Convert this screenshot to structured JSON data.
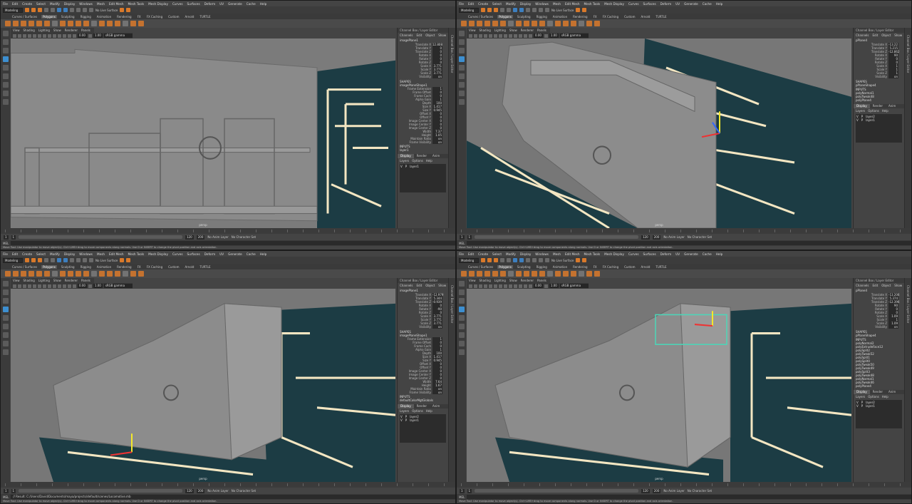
{
  "common": {
    "menus": [
      "File",
      "Edit",
      "Create",
      "Select",
      "Modify",
      "Display",
      "Windows",
      "Mesh",
      "Edit Mesh",
      "Mesh Tools",
      "Mesh Display",
      "Curves",
      "Surfaces",
      "Deform",
      "UV",
      "Generate",
      "Cache",
      "Help"
    ],
    "mode": "Modeling",
    "no_live_surface": "No Live Surface",
    "shelf_tabs": [
      "Curves / Surfaces",
      "Polygons",
      "Sculpting",
      "Rigging",
      "Animation",
      "Rendering",
      "FX",
      "FX Caching",
      "Custom",
      "Arnold",
      "TURTLE"
    ],
    "active_shelf_tab": "Polygons",
    "viewport_menu": [
      "View",
      "Shading",
      "Lighting",
      "Show",
      "Renderer",
      "Panels"
    ],
    "exposure": "0.00",
    "gamma": "1.00",
    "color_space": "sRGB gamma",
    "camera": "persp",
    "panel_title": "Channel Box / Layer Editor",
    "panel_menu": [
      "Channels",
      "Edit",
      "Object",
      "Show"
    ],
    "shapes_label": "SHAPES",
    "inputs_label": "INPUTS",
    "layer_tabs": [
      "Display",
      "Render",
      "Anim"
    ],
    "layer_menu": [
      "Layers",
      "Options",
      "Help"
    ],
    "side_tab": "Channel Box / Layer Editor",
    "range_start": "1",
    "range_end": "120",
    "anim_end": "200",
    "anim_layer": "No Anim Layer",
    "char_set": "No Character Set",
    "mel_label": "MEL",
    "help_text": "Move Tool: Use manipulator to move object(s). Ctrl+LMB+drag to move components along normals. Use D or INSERT to change the pivot position and axis orientation.",
    "colors": {
      "accent": "#d9792a",
      "select": "#3d8fd0",
      "blueprint_bg": "#1b3c44",
      "blueprint_line": "#f3e6c2"
    }
  },
  "quadrants": [
    {
      "object": "imagePlane1",
      "channels": [
        [
          "Translate X",
          "12.808"
        ],
        [
          "Translate Y",
          "0"
        ],
        [
          "Translate Z",
          "0"
        ],
        [
          "Rotate X",
          "0"
        ],
        [
          "Rotate Y",
          "0"
        ],
        [
          "Rotate Z",
          "0"
        ],
        [
          "Scale X",
          "3.771"
        ],
        [
          "Scale Y",
          "3.771"
        ],
        [
          "Scale Z",
          "3.771"
        ],
        [
          "Visibility",
          "on"
        ]
      ],
      "shape": "imagePlaneShape1",
      "shape_attrs": [
        [
          "Frame Extension",
          "1"
        ],
        [
          "Frame Offset",
          "0"
        ],
        [
          "Frame Cach",
          "0"
        ],
        [
          "Alpha Gain",
          "1"
        ],
        [
          "Depth",
          "100"
        ],
        [
          "Size X",
          "1.417"
        ],
        [
          "Size Y",
          "0.945"
        ],
        [
          "Offset X",
          "0"
        ],
        [
          "Offset Y",
          "0"
        ],
        [
          "Image Center X",
          "0"
        ],
        [
          "Image Center Y",
          "0"
        ],
        [
          "Image Center Z",
          "0"
        ],
        [
          "Width",
          "7.37"
        ],
        [
          "Height",
          "1.05"
        ],
        [
          "Maintain Ratio",
          "on"
        ],
        [
          "Frame Visibility",
          "on"
        ]
      ],
      "inputs": [
        "layer1"
      ],
      "layers": [
        [
          "V",
          "P",
          "layer1"
        ]
      ],
      "command": ""
    },
    {
      "object": "pPlane4",
      "channels": [
        [
          "Translate X",
          "-13.22"
        ],
        [
          "Translate Y",
          "5.215"
        ],
        [
          "Translate Z",
          "-12.862"
        ],
        [
          "Rotate X",
          "90"
        ],
        [
          "Rotate Y",
          "0"
        ],
        [
          "Rotate Z",
          "0"
        ],
        [
          "Scale X",
          "1"
        ],
        [
          "Scale Y",
          "1"
        ],
        [
          "Scale Z",
          "1"
        ],
        [
          "Visibility",
          "on"
        ]
      ],
      "shape": "pPlaneShape4",
      "shape_attrs": [],
      "inputs": [
        "polyNormal1",
        "polyTweak48",
        "polyPlane4"
      ],
      "layers": [
        [
          "V",
          "P",
          "layer2"
        ],
        [
          "V",
          "P",
          "layer1"
        ]
      ],
      "command": ""
    },
    {
      "object": "imagePlane1",
      "channels": [
        [
          "Translate X",
          "-12.979"
        ],
        [
          "Translate Y",
          "5.344"
        ],
        [
          "Translate Z",
          "-0.939"
        ],
        [
          "Rotate X",
          "0"
        ],
        [
          "Rotate Y",
          "-90"
        ],
        [
          "Rotate Z",
          "0"
        ],
        [
          "Scale X",
          "3.771"
        ],
        [
          "Scale Y",
          "3.771"
        ],
        [
          "Scale Z",
          "3.771"
        ],
        [
          "Visibility",
          "on"
        ]
      ],
      "shape": "imagePlaneShape1",
      "shape_attrs": [
        [
          "Frame Extension",
          "1"
        ],
        [
          "Frame Offset",
          "0"
        ],
        [
          "Frame Cach",
          "0"
        ],
        [
          "Alpha Gain",
          "1"
        ],
        [
          "Depth",
          "100"
        ],
        [
          "Size X",
          "1.417"
        ],
        [
          "Size Y",
          "0.945"
        ],
        [
          "Offset X",
          "0"
        ],
        [
          "Offset Y",
          "0"
        ],
        [
          "Image Center X",
          "0"
        ],
        [
          "Image Center Y",
          "0"
        ],
        [
          "Image Center Z",
          "0"
        ],
        [
          "Width",
          "7.64"
        ],
        [
          "Height",
          "1.67"
        ],
        [
          "Maintain Ratio",
          "on"
        ],
        [
          "Frame Visibility",
          "on"
        ]
      ],
      "inputs": [
        "defaultColorMgtGlobals"
      ],
      "layers": [
        [
          "V",
          "P",
          "layer2"
        ],
        [
          "V",
          "P",
          "layer1"
        ]
      ],
      "command": "// Result: C:/Users/David/Documents/maya/projects/default/scenes/Locomotive.mb"
    },
    {
      "object": "pPlane4",
      "channels": [
        [
          "Translate X",
          "-13.206"
        ],
        [
          "Translate Y",
          "5.374"
        ],
        [
          "Translate Z",
          "-12.396"
        ],
        [
          "Rotate X",
          "90"
        ],
        [
          "Rotate Y",
          "0"
        ],
        [
          "Rotate Z",
          "0"
        ],
        [
          "Scale X",
          "1.09"
        ],
        [
          "Scale Y",
          "1"
        ],
        [
          "Scale Z",
          "1.09"
        ],
        [
          "Visibility",
          "on"
        ]
      ],
      "shape": "pPlaneShape4",
      "shape_attrs": [],
      "inputs": [
        "polyNormal2",
        "polyExtrudeFace12",
        "polySplit2",
        "polyTweak52",
        "polySplit1",
        "polySplit0",
        "polyTweak50",
        "polyTweak49",
        "polySplit3",
        "polyTweak48",
        "polyNormal1",
        "polyTweak46",
        "polyPlane4"
      ],
      "layers": [
        [
          "V",
          "P",
          "layer2"
        ],
        [
          "V",
          "P",
          "layer1"
        ]
      ],
      "command": ""
    }
  ]
}
